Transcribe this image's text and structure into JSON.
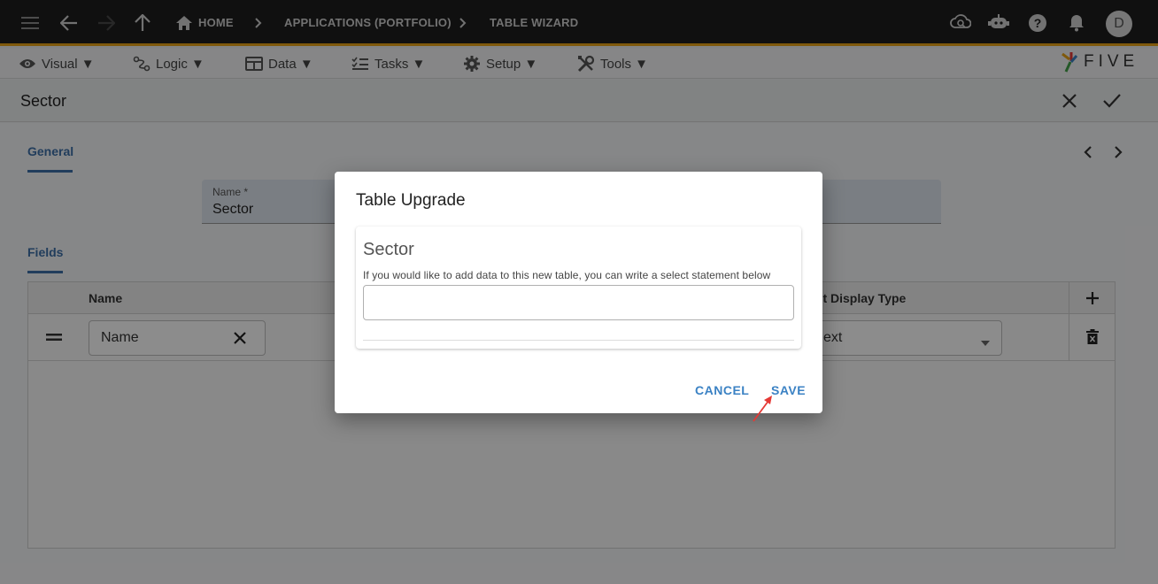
{
  "topbar": {
    "breadcrumbs": [
      {
        "label": "HOME"
      },
      {
        "label": "APPLICATIONS (PORTFOLIO)"
      },
      {
        "label": "TABLE WIZARD"
      }
    ],
    "avatar_initial": "D"
  },
  "menubar": {
    "items": [
      {
        "label": "Visual ▼"
      },
      {
        "label": "Logic ▼"
      },
      {
        "label": "Data ▼"
      },
      {
        "label": "Tasks ▼"
      },
      {
        "label": "Setup ▼"
      },
      {
        "label": "Tools ▼"
      }
    ],
    "logo_text": "FIVE"
  },
  "form": {
    "title": "Sector",
    "tabs": {
      "general": "General",
      "fields": "Fields"
    },
    "name_field": {
      "label": "Name *",
      "value": "Sector"
    },
    "table": {
      "columns": {
        "name": "Name",
        "display_type": "ult Display Type"
      },
      "row": {
        "name_value": "Name",
        "display_type_value": "ext"
      }
    }
  },
  "dialog": {
    "title": "Table Upgrade",
    "card_title": "Sector",
    "description": "If you would like to add data to this new table, you can write a select statement below",
    "sql_value": "",
    "cancel_label": "CANCEL",
    "save_label": "SAVE"
  },
  "colors": {
    "accent": "#3d6fa8",
    "topbar_bg": "#1e1e1e",
    "topbar_border": "#e8a317",
    "button_text": "#3b82c4",
    "annotation_arrow": "#e53935"
  }
}
